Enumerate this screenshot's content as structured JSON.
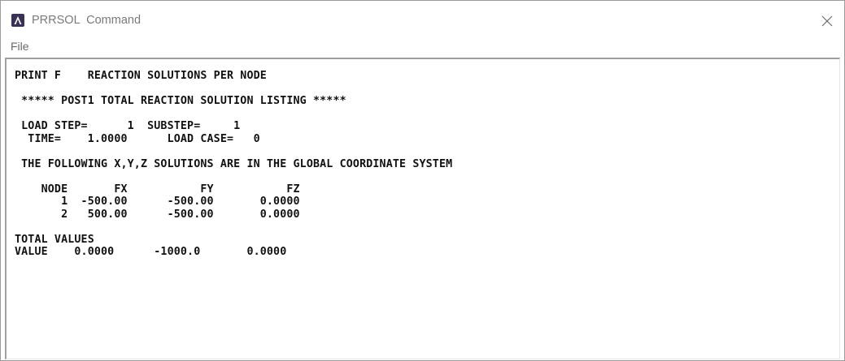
{
  "window": {
    "title": "PRRSOL  Command",
    "app_icon": "ansys-icon",
    "close_icon": "close-icon"
  },
  "menu": {
    "items": [
      "File"
    ]
  },
  "console": {
    "lines": [
      "PRINT F    REACTION SOLUTIONS PER NODE",
      "",
      " ***** POST1 TOTAL REACTION SOLUTION LISTING *****",
      "",
      " LOAD STEP=      1  SUBSTEP=     1",
      "  TIME=    1.0000      LOAD CASE=   0",
      "",
      " THE FOLLOWING X,Y,Z SOLUTIONS ARE IN THE GLOBAL COORDINATE SYSTEM",
      "",
      "    NODE       FX           FY           FZ",
      "       1  -500.00      -500.00       0.0000",
      "       2   500.00      -500.00       0.0000",
      "",
      "TOTAL VALUES",
      "VALUE    0.0000      -1000.0       0.0000"
    ]
  }
}
